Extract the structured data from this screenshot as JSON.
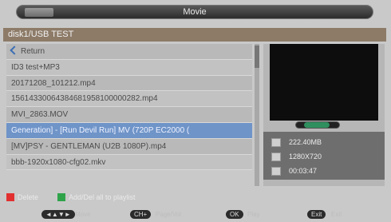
{
  "title": "Movie",
  "path": "disk1/USB TEST",
  "files": [
    {
      "label": "Return",
      "type": "back"
    },
    {
      "label": "ID3 test+MP3"
    },
    {
      "label": "20171208_101212.mp4"
    },
    {
      "label": "15614330064384681958100000282.mp4"
    },
    {
      "label": "MVI_2863.MOV"
    },
    {
      "label": "Generation] - [Run Devil Run] MV (720P EC2000 (",
      "selected": true
    },
    {
      "label": "[MV]PSY - GENTLEMAN (U2B 1080P).mp4"
    },
    {
      "label": "bbb-1920x1080-cfg02.mkv"
    }
  ],
  "info": {
    "size": "222.40MB",
    "resolution": "1280X720",
    "duration": "00:03:47"
  },
  "legend": {
    "red": "Delete",
    "green": "Add/Del all to playlist"
  },
  "bottom_buttons": [
    {
      "key": "◄▲▼►",
      "caption": "Move"
    },
    {
      "key": "CH+",
      "caption": "Page/Vol"
    },
    {
      "key": "OK",
      "caption": "Play"
    },
    {
      "key": "Exit",
      "caption": "Exit"
    }
  ]
}
